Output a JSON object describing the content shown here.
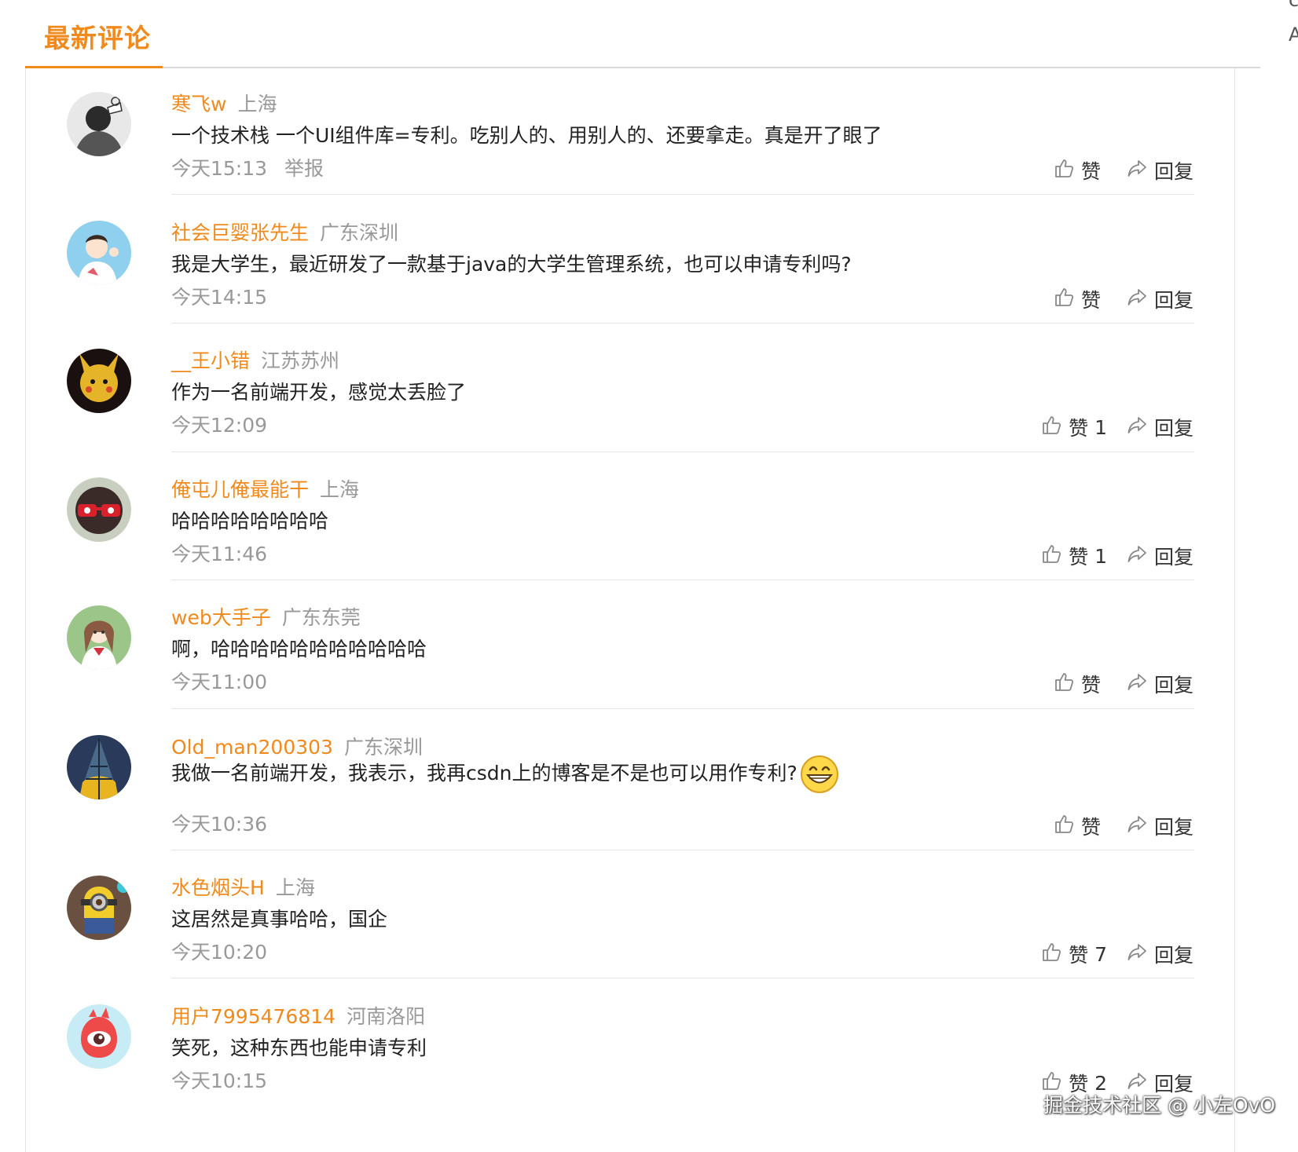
{
  "tabs": {
    "active_label": "最新评论"
  },
  "actions": {
    "like_label": "赞",
    "reply_label": "回复"
  },
  "comments": [
    {
      "username": "寒飞w",
      "location": "上海",
      "text": "一个技术栈 一个UI组件库=专利。吃别人的、用别人的、还要拿走。真是开了眼了",
      "time": "今天15:13",
      "report": "举报",
      "likes": ""
    },
    {
      "username": "社会巨婴张先生",
      "location": "广东深圳",
      "text": "我是大学生，最近研发了一款基于java的大学生管理系统，也可以申请专利吗?",
      "time": "今天14:15",
      "likes": ""
    },
    {
      "username": "__王小错",
      "location": "江苏苏州",
      "text": "作为一名前端开发，感觉太丢脸了",
      "time": "今天12:09",
      "likes": "1"
    },
    {
      "username": "俺屯儿俺最能干",
      "location": "上海",
      "text": "哈哈哈哈哈哈哈哈",
      "time": "今天11:46",
      "likes": "1"
    },
    {
      "username": "web大手子",
      "location": "广东东莞",
      "text": "啊，哈哈哈哈哈哈哈哈哈哈哈",
      "time": "今天11:00",
      "likes": ""
    },
    {
      "username": "Old_man200303",
      "location": "广东深圳",
      "text": "我做一名前端开发，我表示，我再csdn上的博客是不是也可以用作专利?",
      "time": "今天10:36",
      "likes": ""
    },
    {
      "username": "水色烟头H",
      "location": "上海",
      "text": "这居然是真事哈哈，国企",
      "time": "今天10:20",
      "likes": "7"
    },
    {
      "username": "用户7995476814",
      "location": "河南洛阳",
      "text": "笑死，这种东西也能申请专利",
      "time": "今天10:15",
      "likes": "2"
    }
  ],
  "watermark": "掘金技术社区 @ 小左OvO",
  "edge": {
    "top": "c",
    "second": "A"
  },
  "icons": {
    "like": "thumbs-up-icon",
    "reply": "share-arrow-icon",
    "emoji": "grinning-emoji-icon"
  },
  "colors": {
    "accent": "#f08a1d",
    "muted": "#999999",
    "divider": "#e6e6e6"
  }
}
